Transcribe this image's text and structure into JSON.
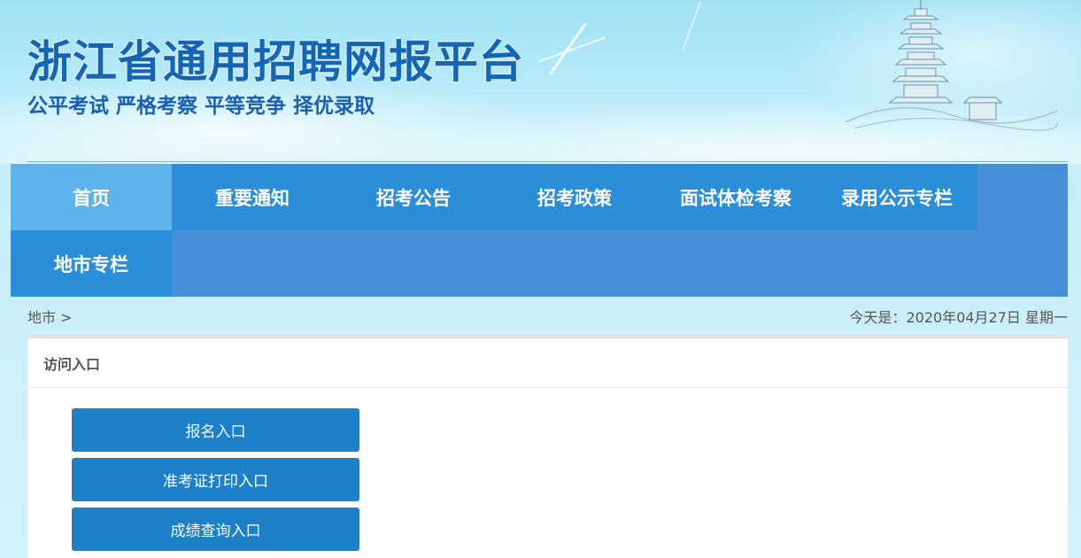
{
  "header": {
    "title": "浙江省通用招聘网报平台",
    "slogan": "公平考试 严格考察 平等竞争 择优录取"
  },
  "nav": {
    "items": [
      {
        "label": "首页",
        "active": true
      },
      {
        "label": "重要通知",
        "active": false
      },
      {
        "label": "招考公告",
        "active": false
      },
      {
        "label": "招考政策",
        "active": false
      },
      {
        "label": "面试体检考察",
        "active": false
      },
      {
        "label": "录用公示专栏",
        "active": false
      },
      {
        "label": "地市专栏",
        "active": false
      }
    ]
  },
  "breadcrumb": {
    "text": "地市 >"
  },
  "today": {
    "text": "今天是：2020年04月27日 星期一"
  },
  "panel": {
    "title": "访问入口",
    "buttons": [
      {
        "label": "报名入口"
      },
      {
        "label": "准考证打印入口"
      },
      {
        "label": "成绩查询入口"
      }
    ]
  },
  "colors": {
    "brand_blue": "#1565b7",
    "nav_bg": "#468fd8",
    "nav_item": "#2b8ed9",
    "nav_active": "#5fb3ec",
    "button": "#1d81c9"
  }
}
